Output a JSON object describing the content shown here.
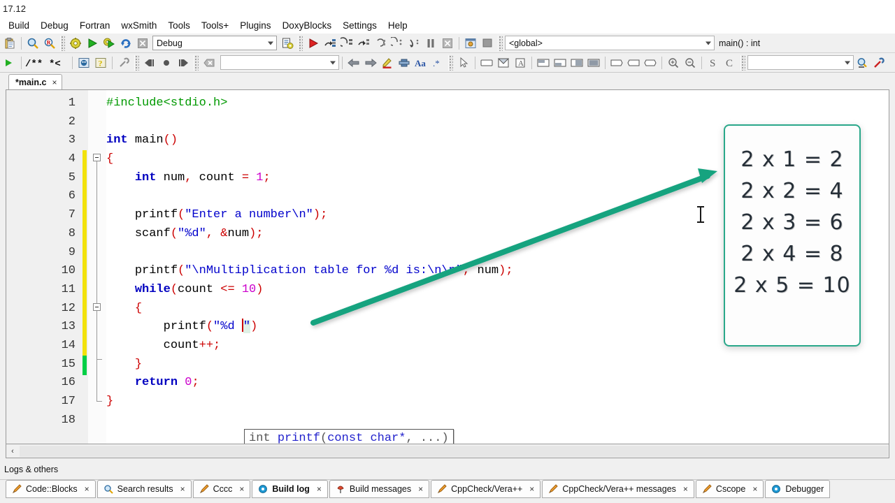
{
  "window": {
    "title": "17.12"
  },
  "menubar": {
    "items": [
      {
        "label": "Build"
      },
      {
        "label": "Debug"
      },
      {
        "label": "Fortran"
      },
      {
        "label": "wxSmith"
      },
      {
        "label": "Tools"
      },
      {
        "label": "Tools+"
      },
      {
        "label": "Plugins"
      },
      {
        "label": "DoxyBlocks"
      },
      {
        "label": "Settings"
      },
      {
        "label": "Help"
      }
    ]
  },
  "toolbar1": {
    "build_target": "Debug",
    "scope_global": "<global>",
    "scope_function": "main() : int",
    "icons": [
      "clipboard-icon",
      "find-icon",
      "find-replace-icon",
      "build-icon",
      "run-icon",
      "build-and-run-icon",
      "rebuild-icon",
      "abort-icon",
      "target-options-icon",
      "debug-continue-icon",
      "debug-run-to-cursor-icon",
      "debug-next-line-icon",
      "debug-step-into-icon",
      "debug-step-out-icon",
      "debug-next-instruction-icon",
      "debug-step-into-instruction-icon",
      "debug-break-icon",
      "debug-stop-icon",
      "debug-info-icon",
      "debug-window-icon"
    ]
  },
  "toolbar2": {
    "search_value": "",
    "search_value2": "",
    "icons": [
      "run-small-icon",
      "doxyblocks-comment-icon",
      "doxyblocks-block-icon",
      "doxyblocks-run-icon",
      "doxyblocks-help-icon",
      "doxyblocks-config-icon",
      "back-icon",
      "stop-icon",
      "forward-icon",
      "clear-icon",
      "prev-icon",
      "next-icon",
      "highlight-icon",
      "bookmark-icon",
      "case-icon",
      "regex-icon",
      "pointer-icon",
      "frame-icon",
      "panel-icon",
      "text-icon",
      "layout-top-icon",
      "layout-bottom-icon",
      "layout-left-icon",
      "layout-fill-icon",
      "shape-rect-icon",
      "shape-left-icon",
      "shape-oval-icon",
      "zoom-in-icon",
      "zoom-out-icon",
      "source-icon",
      "class-icon",
      "search-icon",
      "settings-icon"
    ]
  },
  "editor": {
    "tab": {
      "label": "*main.c",
      "close": "×"
    },
    "line_numbers": [
      "1",
      "2",
      "3",
      "4",
      "5",
      "6",
      "7",
      "8",
      "9",
      "10",
      "11",
      "12",
      "13",
      "14",
      "15",
      "16",
      "17",
      "18"
    ],
    "code_lines": [
      "#include<stdio.h>",
      "",
      "int main()",
      "{",
      "    int num, count = 1;",
      "",
      "    printf(\"Enter a number\\n\");",
      "    scanf(\"%d\", &num);",
      "",
      "    printf(\"\\nMultiplication table for %d is:\\n\\n\", num);",
      "    while(count <= 10)",
      "    {",
      "        printf(\"%d \")",
      "        count++;",
      "    }",
      "    return 0;",
      "}",
      ""
    ],
    "calltip": "int printf(const char*, ...)",
    "scroll_left_arrow": "‹"
  },
  "overlay": {
    "title": "multiplication-table-card",
    "border_color": "#2aa88a",
    "rows": [
      "2 x 1 = 2",
      "2 x 2 = 4",
      "2 x 3 = 6",
      "2 x 4 = 8",
      "2 x 5 = 10"
    ]
  },
  "annotation": {
    "arrow_color": "#12a37f"
  },
  "bottom": {
    "header": "Logs & others",
    "tabs": [
      {
        "label": "Code::Blocks",
        "icon": "pencil-icon",
        "active": false,
        "close": "×"
      },
      {
        "label": "Search results",
        "icon": "magnifier-icon",
        "active": false,
        "close": "×"
      },
      {
        "label": "Cccc",
        "icon": "pencil-icon",
        "active": false,
        "close": "×"
      },
      {
        "label": "Build log",
        "icon": "gear-blue-icon",
        "active": true,
        "close": "×"
      },
      {
        "label": "Build messages",
        "icon": "pin-icon",
        "active": false,
        "close": "×"
      },
      {
        "label": "CppCheck/Vera++",
        "icon": "pencil-icon",
        "active": false,
        "close": "×"
      },
      {
        "label": "CppCheck/Vera++ messages",
        "icon": "pencil-icon",
        "active": false,
        "close": "×"
      },
      {
        "label": "Cscope",
        "icon": "pencil-icon",
        "active": false,
        "close": "×"
      },
      {
        "label": "Debugger",
        "icon": "gear-blue-icon",
        "active": false,
        "close": ""
      }
    ]
  }
}
